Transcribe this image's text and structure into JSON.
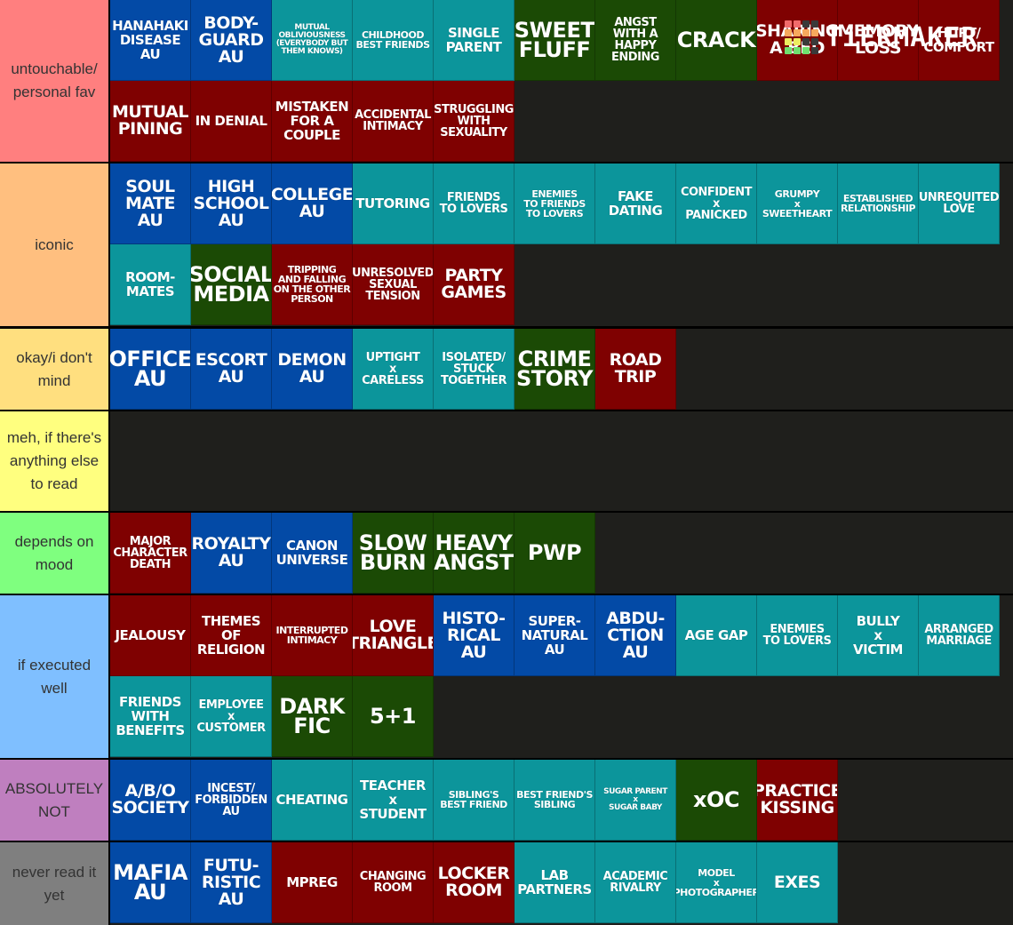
{
  "brand": {
    "name": "TiERMAKER",
    "logo_grid": [
      [
        "#f16b6b",
        "#f16b6b",
        "#3a3a3a",
        "#3a3a3a"
      ],
      [
        "#f7a95d",
        "#f7a95d",
        "#f7a95d",
        "#f7a95d"
      ],
      [
        "#eded5f",
        "#eded5f",
        "#3a3a3a",
        "#3a3a3a"
      ],
      [
        "#6fe06f",
        "#6fe06f",
        "#6fe06f",
        "#3a3a3a"
      ]
    ]
  },
  "colors": {
    "blue": "#034aa6",
    "teal": "#0c959b",
    "green": "#1b4a05",
    "red": "#7f0101",
    "empty_bg": "#1f1f1c"
  },
  "tiers": [
    {
      "label": "untouchable/ personal fav",
      "color": "#ff7f7f",
      "items": [
        {
          "text": "HANAHAKI\nDISEASE\nAU",
          "color": "blue",
          "size": "m"
        },
        {
          "text": "BODY-\nGUARD\nAU",
          "color": "blue",
          "size": "l"
        },
        {
          "text": "MUTUAL\nOBLIVIOUSNESS\n(EVERYBODY BUT THEM KNOWS)",
          "color": "teal",
          "size": "xxs"
        },
        {
          "text": "CHILDHOOD\nBEST FRIENDS",
          "color": "teal",
          "size": "xs"
        },
        {
          "text": "SINGLE\nPARENT",
          "color": "teal",
          "size": "m"
        },
        {
          "text": "SWEET\nFLUFF",
          "color": "green",
          "size": "xl"
        },
        {
          "text": "ANGST\nWITH A\nHAPPY\nENDING",
          "color": "green",
          "size": "s"
        },
        {
          "text": "CRACK",
          "color": "green",
          "size": "xl"
        },
        {
          "text": "SHARING\nA BED",
          "color": "red",
          "size": "l"
        },
        {
          "text": "MEMORY\nLOSS",
          "color": "red",
          "size": "l"
        },
        {
          "text": "HURT/\nCOMFORT",
          "color": "red",
          "size": "m"
        },
        {
          "text": "MUTUAL\nPINING",
          "color": "red",
          "size": "l"
        },
        {
          "text": "IN DENIAL",
          "color": "red",
          "size": "m"
        },
        {
          "text": "MISTAKEN\nFOR A\nCOUPLE",
          "color": "red",
          "size": "m"
        },
        {
          "text": "ACCIDENTAL\nINTIMACY",
          "color": "red",
          "size": "s"
        },
        {
          "text": "STRUGGLING\nWITH\nSEXUALITY",
          "color": "red",
          "size": "s"
        }
      ]
    },
    {
      "label": "iconic",
      "color": "#ffbf7f",
      "items": [
        {
          "text": "SOUL\nMATE\nAU",
          "color": "blue",
          "size": "l"
        },
        {
          "text": "HIGH\nSCHOOL\nAU",
          "color": "blue",
          "size": "l"
        },
        {
          "text": "COLLEGE\nAU",
          "color": "blue",
          "size": "l"
        },
        {
          "text": "TUTORING",
          "color": "teal",
          "size": "m"
        },
        {
          "text": "FRIENDS\nTO LOVERS",
          "color": "teal",
          "size": "s"
        },
        {
          "text": "ENEMIES\nTO FRIENDS\nTO LOVERS",
          "color": "teal",
          "size": "xs"
        },
        {
          "text": "FAKE\nDATING",
          "color": "teal",
          "size": "m"
        },
        {
          "text": "CONFIDENT\nx\nPANICKED",
          "color": "teal",
          "size": "s"
        },
        {
          "text": "GRUMPY\nx\nSWEETHEART",
          "color": "teal",
          "size": "xs"
        },
        {
          "text": "ESTABLISHED\nRELATIONSHIP",
          "color": "teal",
          "size": "xs"
        },
        {
          "text": "UNREQUITED\nLOVE",
          "color": "teal",
          "size": "s"
        },
        {
          "text": "ROOM-\nMATES",
          "color": "teal",
          "size": "m"
        },
        {
          "text": "SOCIAL\nMEDIA",
          "color": "green",
          "size": "xl"
        },
        {
          "text": "TRIPPING\nAND FALLING\nON THE OTHER\nPERSON",
          "color": "red",
          "size": "xs"
        },
        {
          "text": "UNRESOLVED\nSEXUAL\nTENSION",
          "color": "red",
          "size": "s"
        },
        {
          "text": "PARTY\nGAMES",
          "color": "red",
          "size": "l"
        }
      ]
    },
    {
      "label": "okay/i don't mind",
      "color": "#ffdf7f",
      "items": [
        {
          "text": "OFFICE\nAU",
          "color": "blue",
          "size": "xl"
        },
        {
          "text": "ESCORT\nAU",
          "color": "blue",
          "size": "l"
        },
        {
          "text": "DEMON\nAU",
          "color": "blue",
          "size": "l"
        },
        {
          "text": "UPTIGHT\nx\nCARELESS",
          "color": "teal",
          "size": "s"
        },
        {
          "text": "ISOLATED/\nSTUCK\nTOGETHER",
          "color": "teal",
          "size": "s"
        },
        {
          "text": "CRIME\nSTORY",
          "color": "green",
          "size": "xl"
        },
        {
          "text": "ROAD\nTRIP",
          "color": "red",
          "size": "l"
        }
      ]
    },
    {
      "label": "meh, if there's anything else to read",
      "color": "#ffff7f",
      "items": []
    },
    {
      "label": "depends on mood",
      "color": "#7fff7f",
      "items": [
        {
          "text": "MAJOR\nCHARACTER\nDEATH",
          "color": "red",
          "size": "s"
        },
        {
          "text": "ROYALTY\nAU",
          "color": "blue",
          "size": "l"
        },
        {
          "text": "CANON\nUNIVERSE",
          "color": "blue",
          "size": "m"
        },
        {
          "text": "SLOW\nBURN",
          "color": "green",
          "size": "xl"
        },
        {
          "text": "HEAVY\nANGST",
          "color": "green",
          "size": "xl"
        },
        {
          "text": "PWP",
          "color": "green",
          "size": "xl"
        }
      ]
    },
    {
      "label": "if executed well",
      "color": "#7fbfff",
      "items": [
        {
          "text": "JEALOUSY",
          "color": "red",
          "size": "m"
        },
        {
          "text": "THEMES\nOF\nRELIGION",
          "color": "red",
          "size": "m"
        },
        {
          "text": "INTERRUPTED\nINTIMACY",
          "color": "red",
          "size": "xs"
        },
        {
          "text": "LOVE\nTRIANGLE",
          "color": "red",
          "size": "l"
        },
        {
          "text": "HISTO-\nRICAL\nAU",
          "color": "blue",
          "size": "l"
        },
        {
          "text": "SUPER-\nNATURAL\nAU",
          "color": "blue",
          "size": "m"
        },
        {
          "text": "ABDU-\nCTION\nAU",
          "color": "blue",
          "size": "l"
        },
        {
          "text": "AGE GAP",
          "color": "teal",
          "size": "m"
        },
        {
          "text": "ENEMIES\nTO LOVERS",
          "color": "teal",
          "size": "s"
        },
        {
          "text": "BULLY\nx\nVICTIM",
          "color": "teal",
          "size": "m"
        },
        {
          "text": "ARRANGED\nMARRIAGE",
          "color": "teal",
          "size": "s"
        },
        {
          "text": "FRIENDS\nWITH\nBENEFITS",
          "color": "teal",
          "size": "m"
        },
        {
          "text": "EMPLOYEE\nx\nCUSTOMER",
          "color": "teal",
          "size": "s"
        },
        {
          "text": "DARK\nFIC",
          "color": "green",
          "size": "xl"
        },
        {
          "text": "5+1",
          "color": "green",
          "size": "xl"
        }
      ]
    },
    {
      "label": "ABSOLUTELY NOT",
      "color": "#bf7fbf",
      "items": [
        {
          "text": "A/B/O\nSOCIETY",
          "color": "blue",
          "size": "l"
        },
        {
          "text": "INCEST/\nFORBIDDEN\nAU",
          "color": "blue",
          "size": "s"
        },
        {
          "text": "CHEATING",
          "color": "teal",
          "size": "m"
        },
        {
          "text": "TEACHER\nx\nSTUDENT",
          "color": "teal",
          "size": "m"
        },
        {
          "text": "SIBLING'S\nBEST FRIEND",
          "color": "teal",
          "size": "xs"
        },
        {
          "text": "BEST FRIEND'S\nSIBLING",
          "color": "teal",
          "size": "xs"
        },
        {
          "text": "SUGAR PARENT\nx\nSUGAR BABY",
          "color": "teal",
          "size": "xxs"
        },
        {
          "text": "xOC",
          "color": "green",
          "size": "xl"
        },
        {
          "text": "PRACTICE\nKISSING",
          "color": "red",
          "size": "l"
        }
      ]
    },
    {
      "label": "never read it yet",
      "color": "#7f7f7f",
      "items": [
        {
          "text": "MAFIA\nAU",
          "color": "blue",
          "size": "xl"
        },
        {
          "text": "FUTU-\nRISTIC\nAU",
          "color": "blue",
          "size": "l"
        },
        {
          "text": "MPREG",
          "color": "red",
          "size": "m"
        },
        {
          "text": "CHANGING\nROOM",
          "color": "red",
          "size": "s"
        },
        {
          "text": "LOCKER\nROOM",
          "color": "red",
          "size": "l"
        },
        {
          "text": "LAB\nPARTNERS",
          "color": "teal",
          "size": "m"
        },
        {
          "text": "ACADEMIC\nRIVALRY",
          "color": "teal",
          "size": "s"
        },
        {
          "text": "MODEL\nx\nPHOTOGRAPHER",
          "color": "teal",
          "size": "xs"
        },
        {
          "text": "EXES",
          "color": "teal",
          "size": "l"
        }
      ]
    }
  ]
}
